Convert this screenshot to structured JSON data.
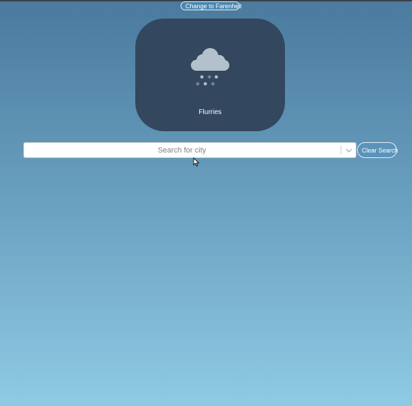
{
  "header": {
    "unit_toggle_label": "Change to Farenheit"
  },
  "weather": {
    "condition": "Flurries",
    "icon": "snow-flurries-icon"
  },
  "search": {
    "placeholder": "Search for city",
    "value": "",
    "dropdown_icon": "chevron-down-icon"
  },
  "actions": {
    "clear_label": "Clear Search"
  },
  "colors": {
    "card_background": "#33475f",
    "gradient_top": "#4a7a9e",
    "gradient_bottom": "#8fcbe4",
    "button_border": "#e6f2fa"
  }
}
